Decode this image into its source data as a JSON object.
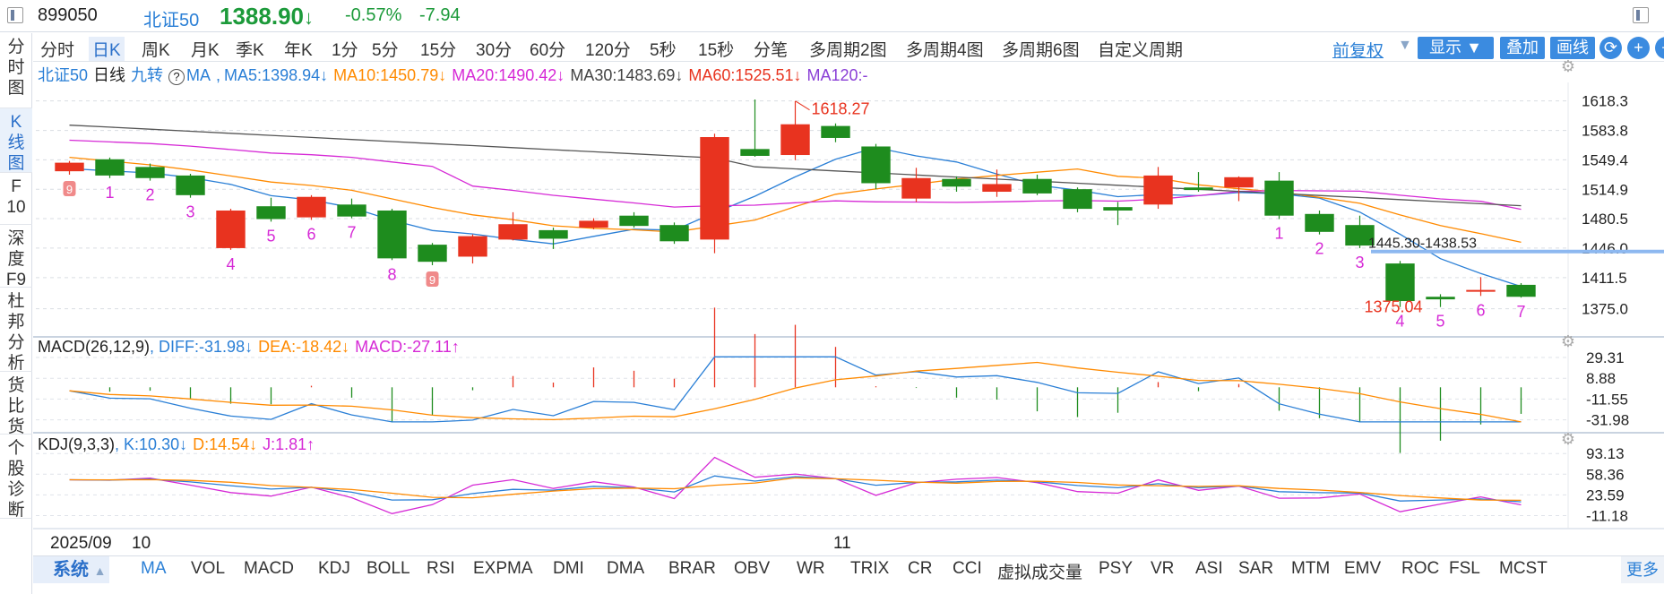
{
  "quote": {
    "code": "899050",
    "name": "北证50",
    "price": "1388.90",
    "arrow": "↓",
    "change_pct": "-0.57%",
    "change": "-7.94"
  },
  "left_nav": [
    {
      "label": "分\n时\n图",
      "active": false
    },
    {
      "label": "K\n线\n图",
      "active": true
    },
    {
      "label": "F\n10",
      "active": false
    },
    {
      "label": "深\n度\nF9",
      "active": false
    },
    {
      "label": "杜\n邦\n分\n析",
      "active": false
    },
    {
      "label": "货\n比\n货",
      "active": false
    },
    {
      "label": "个\n股\n诊\n断",
      "active": false
    }
  ],
  "period_tabs": [
    "分时",
    "日K",
    "周K",
    "月K",
    "季K",
    "年K",
    "1分",
    "5分",
    "15分",
    "30分",
    "60分",
    "120分",
    "5秒",
    "15秒",
    "分笔",
    "多周期2图",
    "多周期4图",
    "多周期6图",
    "自定义周期"
  ],
  "active_period": "日K",
  "right_tools": {
    "restore": "前复权",
    "display": "显示",
    "overlay": "叠加",
    "draw": "画线"
  },
  "ma_legend": {
    "name": "北证50",
    "period": "日线",
    "nine": "九转",
    "ma": "MA",
    "ma5": "MA5:1398.94↓",
    "ma10": "MA10:1450.79↓",
    "ma20": "MA20:1490.42↓",
    "ma30": "MA30:1483.69↓",
    "ma60": "MA60:1525.51↓",
    "ma120": "MA120:-"
  },
  "macd_legend": {
    "name": "MACD(26,12,9)",
    "diff": ", DIFF:-31.98↓",
    "dea": "DEA:-18.42↓",
    "macd": "MACD:-27.11↑"
  },
  "kdj_legend": {
    "name": "KDJ(9,3,3)",
    "k": ", K:10.30↓",
    "d": "D:14.54↓",
    "j": "J:1.81↑"
  },
  "x_axis": {
    "year": "2025/09",
    "m10": "10",
    "m11": "11"
  },
  "bottom_tabs": [
    "MA",
    "VOL",
    "MACD",
    "KDJ",
    "BOLL",
    "RSI",
    "EXPMA",
    "DMI",
    "DMA",
    "BRAR",
    "OBV",
    "WR",
    "TRIX",
    "CR",
    "CCI",
    "虚拟成交量",
    "PSY",
    "VR",
    "ASI",
    "SAR",
    "MTM",
    "EMV",
    "ROC",
    "FSL",
    "MCST"
  ],
  "system_tab": "系统",
  "more_label": "更多",
  "colors": {
    "up": "#e8331f",
    "down": "#1e8c1e",
    "blue": "#2a7fd6",
    "orange": "#ff8a00",
    "magenta": "#d62ad6",
    "gray": "#555555"
  },
  "chart_data": [
    {
      "type": "candlestick",
      "title": "北证50 日线",
      "y_ticks": [
        "1618.3",
        "1583.8",
        "1549.4",
        "1514.9",
        "1480.5",
        "1446.0",
        "1411.5",
        "1375.0"
      ],
      "ylim": [
        1362,
        1640
      ],
      "candles": [
        {
          "o": 1536,
          "c": 1546,
          "h": 1548,
          "l": 1532
        },
        {
          "o": 1550,
          "c": 1531,
          "h": 1552,
          "l": 1528
        },
        {
          "o": 1541,
          "c": 1528,
          "h": 1545,
          "l": 1525
        },
        {
          "o": 1531,
          "c": 1508,
          "h": 1533,
          "l": 1505
        },
        {
          "o": 1446,
          "c": 1490,
          "h": 1492,
          "l": 1444
        },
        {
          "o": 1495,
          "c": 1480,
          "h": 1505,
          "l": 1477
        },
        {
          "o": 1482,
          "c": 1506,
          "h": 1508,
          "l": 1479
        },
        {
          "o": 1497,
          "c": 1483,
          "h": 1504,
          "l": 1481
        },
        {
          "o": 1490,
          "c": 1434,
          "h": 1492,
          "l": 1432
        },
        {
          "o": 1450,
          "c": 1430,
          "h": 1452,
          "l": 1426
        },
        {
          "o": 1436,
          "c": 1460,
          "h": 1462,
          "l": 1428
        },
        {
          "o": 1456,
          "c": 1474,
          "h": 1488,
          "l": 1455
        },
        {
          "o": 1467,
          "c": 1457,
          "h": 1470,
          "l": 1445
        },
        {
          "o": 1470,
          "c": 1478,
          "h": 1481,
          "l": 1468
        },
        {
          "o": 1484,
          "c": 1472,
          "h": 1488,
          "l": 1470
        },
        {
          "o": 1473,
          "c": 1454,
          "h": 1476,
          "l": 1451
        },
        {
          "o": 1456,
          "c": 1576,
          "h": 1580,
          "l": 1440
        },
        {
          "o": 1562,
          "c": 1554,
          "h": 1620,
          "l": 1553
        },
        {
          "o": 1555,
          "c": 1591,
          "h": 1618,
          "l": 1549
        },
        {
          "o": 1589,
          "c": 1575,
          "h": 1592,
          "l": 1570
        },
        {
          "o": 1565,
          "c": 1522,
          "h": 1568,
          "l": 1515
        },
        {
          "o": 1504,
          "c": 1528,
          "h": 1540,
          "l": 1500
        },
        {
          "o": 1527,
          "c": 1518,
          "h": 1530,
          "l": 1512
        },
        {
          "o": 1512,
          "c": 1521,
          "h": 1538,
          "l": 1506
        },
        {
          "o": 1527,
          "c": 1510,
          "h": 1532,
          "l": 1508
        },
        {
          "o": 1515,
          "c": 1492,
          "h": 1517,
          "l": 1488
        },
        {
          "o": 1494,
          "c": 1490,
          "h": 1500,
          "l": 1473
        },
        {
          "o": 1497,
          "c": 1531,
          "h": 1541,
          "l": 1492
        },
        {
          "o": 1517,
          "c": 1514,
          "h": 1535,
          "l": 1512
        },
        {
          "o": 1517,
          "c": 1529,
          "h": 1530,
          "l": 1501
        },
        {
          "o": 1525,
          "c": 1484,
          "h": 1535,
          "l": 1480
        },
        {
          "o": 1486,
          "c": 1465,
          "h": 1490,
          "l": 1462
        },
        {
          "o": 1473,
          "c": 1449,
          "h": 1484,
          "l": 1446
        },
        {
          "o": 1428,
          "c": 1384,
          "h": 1431,
          "l": 1377
        },
        {
          "o": 1389,
          "c": 1386,
          "h": 1392,
          "l": 1377
        },
        {
          "o": 1396,
          "c": 1397,
          "h": 1412,
          "l": 1390
        },
        {
          "o": 1403,
          "c": 1389,
          "h": 1405,
          "l": 1388
        }
      ],
      "nine_labels": [
        "9",
        "1",
        "2",
        "3",
        "4",
        "5",
        "6",
        "7",
        "8",
        "9",
        "",
        "",
        "",
        "",
        "",
        "",
        "",
        "",
        "",
        "",
        "",
        "",
        "",
        "",
        "",
        "",
        "",
        "",
        "",
        "",
        "1",
        "2",
        "3",
        "4",
        "5",
        "6",
        "7"
      ],
      "annotations": {
        "high": "1618.27",
        "low": "1375.04",
        "range": "1445.30-1438.53"
      }
    },
    {
      "type": "line",
      "title": "MACD(26,12,9)",
      "y_ticks": [
        "29.31",
        "8.88",
        "-11.55",
        "-31.98"
      ],
      "ylim": [
        -35,
        32
      ]
    },
    {
      "type": "line",
      "title": "KDJ(9,3,3)",
      "y_ticks": [
        "93.13",
        "58.36",
        "23.59",
        "-11.18"
      ],
      "ylim": [
        -15,
        98
      ]
    }
  ]
}
